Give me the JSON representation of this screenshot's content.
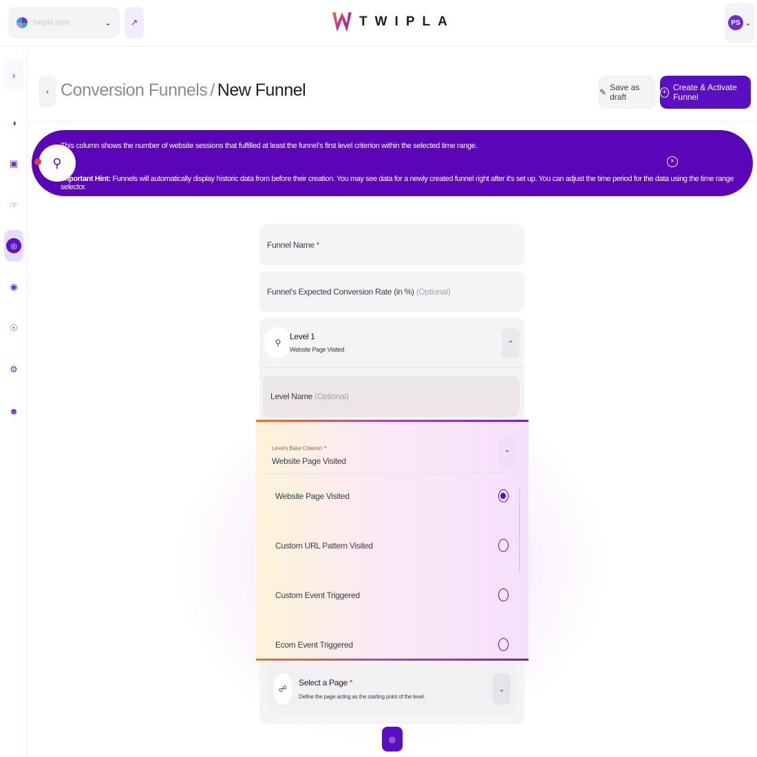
{
  "topbar": {
    "site": "helpla.com",
    "logo_text": "TWIPLA",
    "user_initials": "PS"
  },
  "sidebar": {
    "items": [
      {
        "icon": "expand-icon",
        "active": false
      },
      {
        "icon": "analytics-icon",
        "active": false
      },
      {
        "icon": "ecommerce-icon",
        "active": false
      },
      {
        "icon": "behavior-icon",
        "active": false
      },
      {
        "icon": "funnels-icon",
        "active": true
      },
      {
        "icon": "feedback-icon",
        "active": false
      },
      {
        "icon": "privacy-icon",
        "active": false
      },
      {
        "icon": "settings-icon",
        "active": false
      },
      {
        "icon": "support-icon",
        "active": false
      }
    ]
  },
  "header": {
    "breadcrumb_parent": "Conversion Funnels",
    "separator": "/",
    "title": "New Funnel",
    "save_draft_label": "Save as draft",
    "create_label": "Create & Activate Funnel"
  },
  "banner": {
    "line1": "This column shows the number of website sessions that fulfilled at least the funnel's first level criterion within the selected time range.",
    "hint_label": "Important Hint:",
    "hint_text": "Funnels will automatically display historic data from before their creation. You may see data for a newly created funnel right after it's set up. You can adjust the time period for the data using the time range selector."
  },
  "form": {
    "funnel_name_label": "Funnel Name",
    "conversion_rate_label": "Funnel's Expected Conversion Rate (in %)",
    "optional": "(Optional)",
    "required_mark": "*"
  },
  "level": {
    "title": "Level 1",
    "subtitle": "Website Page Visited",
    "level_name_label": "Level Name"
  },
  "criterion": {
    "label": "Level's Base Criterion",
    "value": "Website Page Visited",
    "options": [
      {
        "label": "Website Page Visited",
        "selected": true
      },
      {
        "label": "Custom URL Pattern Visited",
        "selected": false
      },
      {
        "label": "Custom Event Triggered",
        "selected": false
      },
      {
        "label": "Ecom Event Triggered",
        "selected": false
      }
    ]
  },
  "page_select": {
    "title": "Select a Page",
    "subtitle": "Define the page acting as the starting point of the level."
  },
  "colors": {
    "brand": "#5a0fc2",
    "banner": "#5a05b8",
    "required": "#e0262e"
  }
}
